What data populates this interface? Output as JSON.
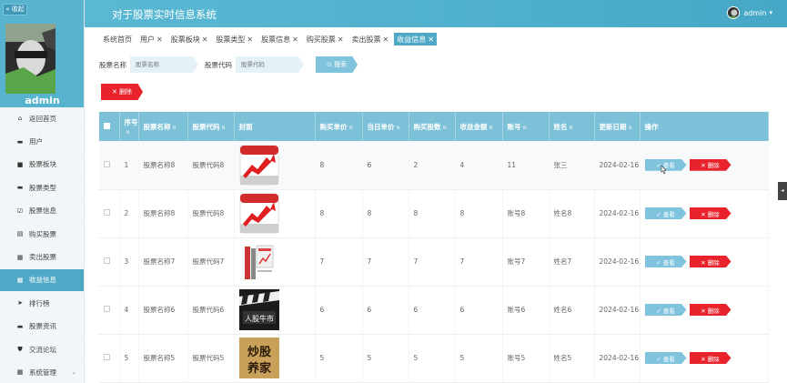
{
  "sidebar": {
    "collapse_label": "« 收起",
    "username": "admin",
    "items": [
      {
        "label": "返回首页",
        "icon": "home-icon",
        "glyph": "⌂"
      },
      {
        "label": "用户",
        "icon": "monitor-icon",
        "glyph": "▬"
      },
      {
        "label": "股票板块",
        "icon": "video-icon",
        "glyph": "■"
      },
      {
        "label": "股票类型",
        "icon": "monitor-icon",
        "glyph": "▬"
      },
      {
        "label": "股票信息",
        "icon": "check-square-icon",
        "glyph": "☑"
      },
      {
        "label": "购买股票",
        "icon": "doc-icon",
        "glyph": "▤"
      },
      {
        "label": "卖出股票",
        "icon": "grid-icon",
        "glyph": "▦"
      },
      {
        "label": "收益信息",
        "icon": "grid-icon",
        "glyph": "▦",
        "active": true
      },
      {
        "label": "排行榜",
        "icon": "send-icon",
        "glyph": "➤"
      },
      {
        "label": "股票资讯",
        "icon": "monitor-icon",
        "glyph": "▬"
      },
      {
        "label": "交流论坛",
        "icon": "shield-icon",
        "glyph": "⛊"
      },
      {
        "label": "系统管理",
        "icon": "grid-icon",
        "glyph": "▦",
        "caret": "⌄"
      }
    ]
  },
  "header": {
    "title": "对于股票实时信息系统",
    "user": "admin",
    "user_caret": "▾"
  },
  "tabs": [
    {
      "label": "系统首页",
      "closable": false
    },
    {
      "label": "用户",
      "closable": true
    },
    {
      "label": "股票板块",
      "closable": true
    },
    {
      "label": "股票类型",
      "closable": true
    },
    {
      "label": "股票信息",
      "closable": true
    },
    {
      "label": "购买股票",
      "closable": true
    },
    {
      "label": "卖出股票",
      "closable": true
    },
    {
      "label": "收益信息",
      "closable": true,
      "active": true
    }
  ],
  "search": {
    "name_label": "股票名称",
    "name_placeholder": "股票名称",
    "code_label": "股票代码",
    "code_placeholder": "股票代码",
    "button_label": "⊙ 搜索"
  },
  "delete_button_label": "✕ 删除",
  "table": {
    "columns": [
      "序号",
      "股票名称",
      "股票代码",
      "封面",
      "购买单价",
      "当日单价",
      "购买股数",
      "收益金额",
      "账号",
      "姓名",
      "更新日期",
      "操作"
    ],
    "view_label": "✓ 查看",
    "delete_label": "✕ 删除",
    "rows": [
      {
        "index": "1",
        "name": "股票名称8",
        "code": "股票代码8",
        "cover": "red-chart",
        "buy_price": "8",
        "day_price": "6",
        "shares": "2",
        "profit": "4",
        "account": "11",
        "person": "张三",
        "date": "2024-02-16"
      },
      {
        "index": "2",
        "name": "股票名称8",
        "code": "股票代码8",
        "cover": "red-chart",
        "buy_price": "8",
        "day_price": "8",
        "shares": "8",
        "profit": "8",
        "account": "账号8",
        "person": "姓名8",
        "date": "2024-02-16"
      },
      {
        "index": "3",
        "name": "股票名称7",
        "code": "股票代码7",
        "cover": "books",
        "buy_price": "7",
        "day_price": "7",
        "shares": "7",
        "profit": "7",
        "account": "账号7",
        "person": "姓名7",
        "date": "2024-02-16"
      },
      {
        "index": "4",
        "name": "股票名称6",
        "code": "股票代码6",
        "cover": "movie",
        "buy_price": "6",
        "day_price": "6",
        "shares": "6",
        "profit": "6",
        "account": "账号6",
        "person": "姓名6",
        "date": "2024-02-16"
      },
      {
        "index": "5",
        "name": "股票名称5",
        "code": "股票代码5",
        "cover": "calligraphy",
        "buy_price": "5",
        "day_price": "5",
        "shares": "5",
        "profit": "5",
        "account": "账号5",
        "person": "姓名5",
        "date": "2024-02-16"
      }
    ]
  },
  "colors": {
    "primary": "#4fa9c6",
    "header_bg": "#7cc1d8",
    "danger": "#e8232c",
    "light_button": "#7fc4dc"
  }
}
